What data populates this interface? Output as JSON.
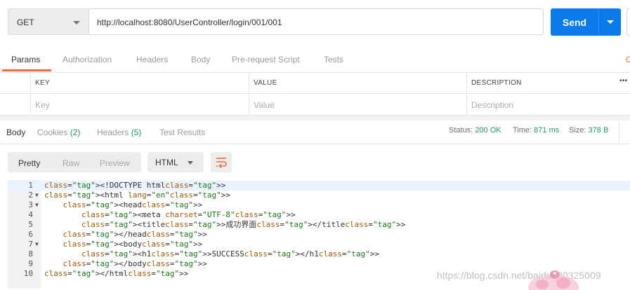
{
  "request": {
    "method": "GET",
    "url": "http://localhost:8080/UserController/login/001/001",
    "send_label": "Send"
  },
  "request_tabs": [
    {
      "label": "Params",
      "active": true
    },
    {
      "label": "Authorization"
    },
    {
      "label": "Headers"
    },
    {
      "label": "Body"
    },
    {
      "label": "Pre-request Script"
    },
    {
      "label": "Tests"
    }
  ],
  "cookies_fragment": "C",
  "params_table": {
    "headers": [
      "KEY",
      "VALUE",
      "DESCRIPTION"
    ],
    "placeholders": [
      "Key",
      "Value",
      "Description"
    ],
    "more": "•••"
  },
  "response": {
    "tabs": [
      {
        "label": "Body",
        "count": "",
        "active": true
      },
      {
        "label": "Cookies",
        "count": "(2)"
      },
      {
        "label": "Headers",
        "count": "(5)"
      },
      {
        "label": "Test Results",
        "count": ""
      }
    ],
    "status_label": "Status:",
    "status_value": "200 OK",
    "time_label": "Time:",
    "time_value": "871 ms",
    "size_label": "Size:",
    "size_value": "378 B"
  },
  "view": {
    "modes": [
      "Pretty",
      "Raw",
      "Preview"
    ],
    "active_mode": "Pretty",
    "format": "HTML"
  },
  "code_lines": [
    {
      "n": "1",
      "fold": "",
      "text": "<!DOCTYPE html>"
    },
    {
      "n": "2",
      "fold": "▼",
      "text": "<html lang=\"en\">"
    },
    {
      "n": "3",
      "fold": "▼",
      "text": "    <head>"
    },
    {
      "n": "4",
      "fold": "",
      "text": "        <meta charset=\"UTF-8\">"
    },
    {
      "n": "5",
      "fold": "",
      "text": "        <title>成功界面</title>"
    },
    {
      "n": "6",
      "fold": "",
      "text": "    </head>"
    },
    {
      "n": "7",
      "fold": "▼",
      "text": "    <body>"
    },
    {
      "n": "8",
      "fold": "",
      "text": "        <h1>SUCCESS</h1>"
    },
    {
      "n": "9",
      "fold": "",
      "text": "    </body>"
    },
    {
      "n": "10",
      "fold": "",
      "text": "</html>"
    }
  ],
  "watermark": "https://blog.csdn.net/baidu_30325009",
  "colors": {
    "accent_orange": "#f26b3a",
    "send_blue": "#097bed",
    "status_green": "#1e9c5d"
  }
}
